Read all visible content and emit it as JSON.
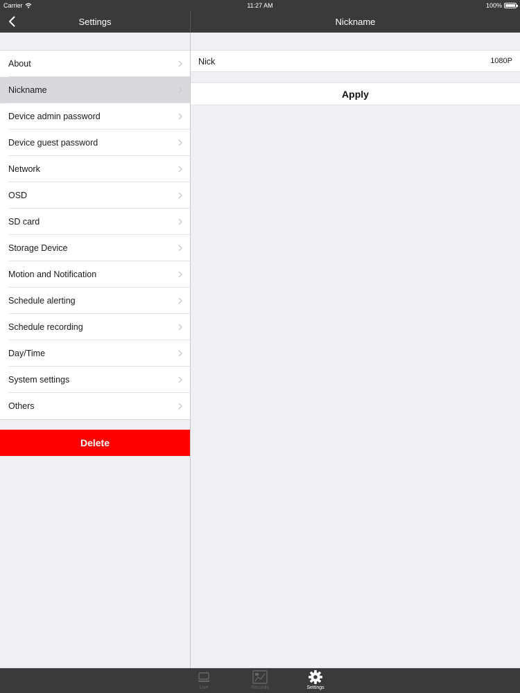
{
  "status_bar": {
    "carrier": "Carrier",
    "time": "11:27 AM",
    "battery": "100%"
  },
  "master": {
    "title": "Settings",
    "menu": [
      {
        "label": "About",
        "selected": false
      },
      {
        "label": "Nickname",
        "selected": true
      },
      {
        "label": "Device admin password",
        "selected": false
      },
      {
        "label": "Device guest password",
        "selected": false
      },
      {
        "label": "Network",
        "selected": false
      },
      {
        "label": "OSD",
        "selected": false
      },
      {
        "label": "SD card",
        "selected": false
      },
      {
        "label": "Storage Device",
        "selected": false
      },
      {
        "label": "Motion and Notification",
        "selected": false
      },
      {
        "label": "Schedule alerting",
        "selected": false
      },
      {
        "label": "Schedule recording",
        "selected": false
      },
      {
        "label": "Day/Time",
        "selected": false
      },
      {
        "label": "System settings",
        "selected": false
      },
      {
        "label": "Others",
        "selected": false
      }
    ],
    "delete_label": "Delete"
  },
  "detail": {
    "title": "Nickname",
    "nickname_value": "Nick",
    "resolution": "1080P",
    "apply_label": "Apply"
  },
  "tab_bar": {
    "tabs": [
      {
        "label": "Live",
        "icon": "laptop-icon",
        "active": false
      },
      {
        "label": "Records",
        "icon": "records-icon",
        "active": false
      },
      {
        "label": "Settings",
        "icon": "gear-icon",
        "active": true
      }
    ]
  },
  "colors": {
    "bar_background": "#3a3a3a",
    "page_background": "#efeff4",
    "delete_red": "#ff0000",
    "selected_row": "#d9d9dd"
  }
}
